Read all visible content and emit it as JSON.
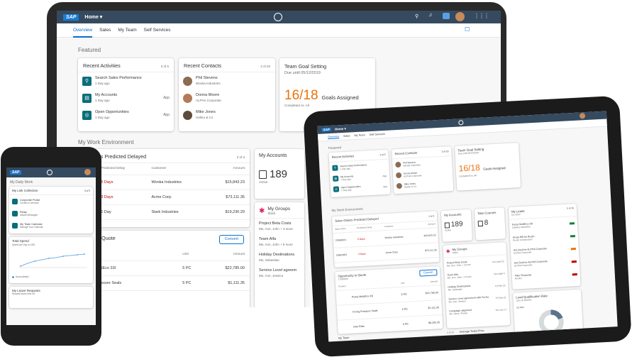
{
  "laptop": {
    "shell": {
      "logo": "SAP",
      "home": "Home ▾"
    },
    "tabs": [
      "Overview",
      "Sales",
      "My Team",
      "Self Services"
    ],
    "featured_title": "Featured",
    "recent_activities": {
      "title": "Recent Activities",
      "count": "3 of 5",
      "items": [
        {
          "title": "Search Sales Performance",
          "sub": "1 Day ago",
          "right": "",
          "icon": "search-icon"
        },
        {
          "title": "My Accounts",
          "sub": "1 Day ago",
          "right": "App",
          "icon": "accounts-icon"
        },
        {
          "title": "Open Opportunities",
          "sub": "1 Day ago",
          "right": "App",
          "icon": "opportunities-icon"
        }
      ]
    },
    "recent_contacts": {
      "title": "Recent Contacts",
      "count": "3 of 20",
      "items": [
        {
          "name": "Phil Stevens",
          "company": "Wonka Industries"
        },
        {
          "name": "Donna Moore",
          "company": "ALPHA Corporate"
        },
        {
          "name": "Mike Jones",
          "company": "Gekko & Co"
        }
      ]
    },
    "team_goal": {
      "title": "Team Goal Setting",
      "due": "Due until 05/12/2019",
      "value": "16/18",
      "label": "Goals Assigned",
      "sub": "Completed vs. All"
    },
    "work_env_title": "My Work Environment",
    "sales_orders": {
      "title": "orders Predicted Delayed",
      "count": "3 of 3",
      "headers": [
        "Predicted Delay",
        "Customer",
        "Amount"
      ],
      "rows": [
        {
          "id": "4",
          "delay": "5 Days",
          "customer": "Wonka Industries",
          "amount": "$15,843.23"
        },
        {
          "id": "3",
          "delay": "3 Days",
          "customer": "Acme Corp.",
          "amount": "$73,111.35"
        },
        {
          "id": "0",
          "delay": "1 Day",
          "customer": "Stark Industries",
          "amount": "$19,230.29"
        }
      ]
    },
    "quote": {
      "title": "unity to Quote",
      "sub": "y",
      "convert": "Convert",
      "headers": [
        "Unit",
        "Amount"
      ],
      "rows": [
        {
          "product": "Pump MultiEco 33I",
          "unit": "5 PC",
          "amount": "$22,785.00"
        },
        {
          "product": "O-ring Pressure Seals",
          "unit": "5 PC",
          "amount": "$1,111.35"
        }
      ]
    },
    "my_accounts": {
      "title": "My Accounts",
      "value": "189",
      "sub": "Active"
    },
    "my_groups": {
      "title": "My Groups",
      "sub": "Slack",
      "items": [
        {
          "title": "Project Beta Costs",
          "sub": "Me, Ann, John + 3 more"
        },
        {
          "title": "Team Alfa",
          "sub": "Me, Ann, John + 8 more"
        },
        {
          "title": "Holiday Destinations",
          "sub": "Me, Sebastian"
        },
        {
          "title": "Service Level agreem",
          "sub": "Me, Ann, Jessica"
        }
      ]
    }
  },
  "phone": {
    "logo": "SAP",
    "title": "My Daily Work",
    "link_collection": {
      "title": "My Link Collection",
      "count": "3 of 9",
      "items": [
        {
          "title": "Corporate Portal",
          "sub": "Content & services"
        },
        {
          "title": "Relay",
          "sub": "Instant Messages"
        },
        {
          "title": "My Team Calendar",
          "sub": "Manage Your Calendar"
        }
      ]
    },
    "spend": {
      "title": "Total Spend",
      "sub": "Spend per Day in USD",
      "legend": "Accumulated",
      "y_ticks": [
        "10K",
        "5K",
        "0"
      ]
    },
    "leave": {
      "title": "My Leave Requests",
      "sub": "Request some time off"
    }
  },
  "tablet": {
    "shell": {
      "logo": "SAP",
      "home": "Home ▾"
    },
    "tabs": [
      "Overview",
      "Sales",
      "My Team",
      "Self Services"
    ],
    "featured_title": "Featured",
    "recent_activities": {
      "title": "Recent Activities",
      "count": "3 of 5",
      "items": [
        {
          "title": "Search Sales Performance",
          "sub": "1 Day ago",
          "right": ""
        },
        {
          "title": "My Accounts",
          "sub": "1 Day ago",
          "right": "App"
        },
        {
          "title": "Open Opportunities",
          "sub": "1 Day ago",
          "right": "App"
        }
      ]
    },
    "recent_contacts": {
      "title": "Recent Contacts",
      "count": "3 of 20",
      "items": [
        {
          "name": "Phil Stevens",
          "company": "Wonka Industries"
        },
        {
          "name": "Donna Moore",
          "company": "ALPHA Corporate"
        },
        {
          "name": "Mike Jones",
          "company": "Gekko & Co"
        }
      ]
    },
    "team_goal": {
      "title": "Team Goal Setting",
      "due": "Due until 05/12/2019",
      "value": "16/18",
      "label": "Goals Assigned",
      "sub": "Completed vs. All"
    },
    "work_env_title": "My Work Environment",
    "sales_orders": {
      "title": "Sales Orders Predicted Delayed",
      "count": "3 of 3",
      "headers": [
        "Sales Order",
        "Predicted Delay",
        "Customer",
        "Amount"
      ],
      "rows": [
        {
          "id": "23456824",
          "delay": "5 Days",
          "customer": "Wonka Industries",
          "amount": "$15,843.23"
        },
        {
          "id": "34567963",
          "delay": "3 Days",
          "customer": "Acme Corp.",
          "amount": "$73,111.35"
        },
        {
          "id": "45673820",
          "delay": "1 Day",
          "customer": "Stark Industries",
          "amount": "$19,230.29"
        }
      ]
    },
    "quote": {
      "title": "Opportunity to Quote",
      "sub": "17456356",
      "convert": "Convert",
      "headers": [
        "Product",
        "Unit",
        "Amount"
      ],
      "rows": [
        {
          "product": "Pump MultiEco 33I",
          "unit": "5 PC",
          "amount": "$22,785.00"
        },
        {
          "product": "O-ring Pressure Seals",
          "unit": "5 PC",
          "amount": "$1,111.35"
        },
        {
          "product": "Inlet Filter",
          "unit": "5 PC",
          "amount": "$6,200.35"
        }
      ]
    },
    "my_accounts": {
      "title": "My Accounts",
      "value": "189",
      "sub": "Active"
    },
    "take_courses": {
      "title": "Take Courses",
      "value": "8"
    },
    "my_groups": {
      "title": "My Groups",
      "sub": "Slack",
      "items": [
        {
          "title": "Project Beta Costs",
          "sub": "Me, Ann, John + 3 more",
          "right": "Tue April 23"
        },
        {
          "title": "Team Alfa",
          "sub": "Me, Ann, John + 8 more",
          "right": "Sun April 4"
        },
        {
          "title": "Holiday Destinations",
          "sub": "Me, Sebastian",
          "right": "Fri Feb 23"
        },
        {
          "title": "Service Level agreement with Fecha",
          "sub": "Me, Ann, Jessica",
          "right": "Fri Feb 23"
        },
        {
          "title": "Campaign alignment",
          "sub": "Me, Steve, Florian",
          "right": "Thu Jan 17"
        }
      ]
    },
    "my_leads": {
      "title": "My Leads",
      "sub": "Q1 2019",
      "count": "5 of 10",
      "items": [
        {
          "title": "Pump MultiEco 33I",
          "sub": "Gekkos Industries",
          "badge": "green"
        },
        {
          "title": "Gross Bill for Rustic",
          "sub": "Rustic Construction",
          "badge": "green"
        },
        {
          "title": "Hot Deal for ALPHA Corporate",
          "sub": "ALPHA Corporate",
          "badge": "orange"
        },
        {
          "title": "Hot Deal for ALPHA Corporate",
          "sub": "ALPHA Corporate",
          "badge": "red"
        },
        {
          "title": "Filter Requests",
          "sub": "Renlux",
          "badge": "red"
        }
      ]
    },
    "lead_rate": {
      "title": "Lead Qualification Rate",
      "sub": "Last 10 Months",
      "value": "19.76%"
    },
    "bottom": {
      "left": "My Team",
      "count": "3 of 15",
      "right": "Average Ticket Price"
    }
  }
}
